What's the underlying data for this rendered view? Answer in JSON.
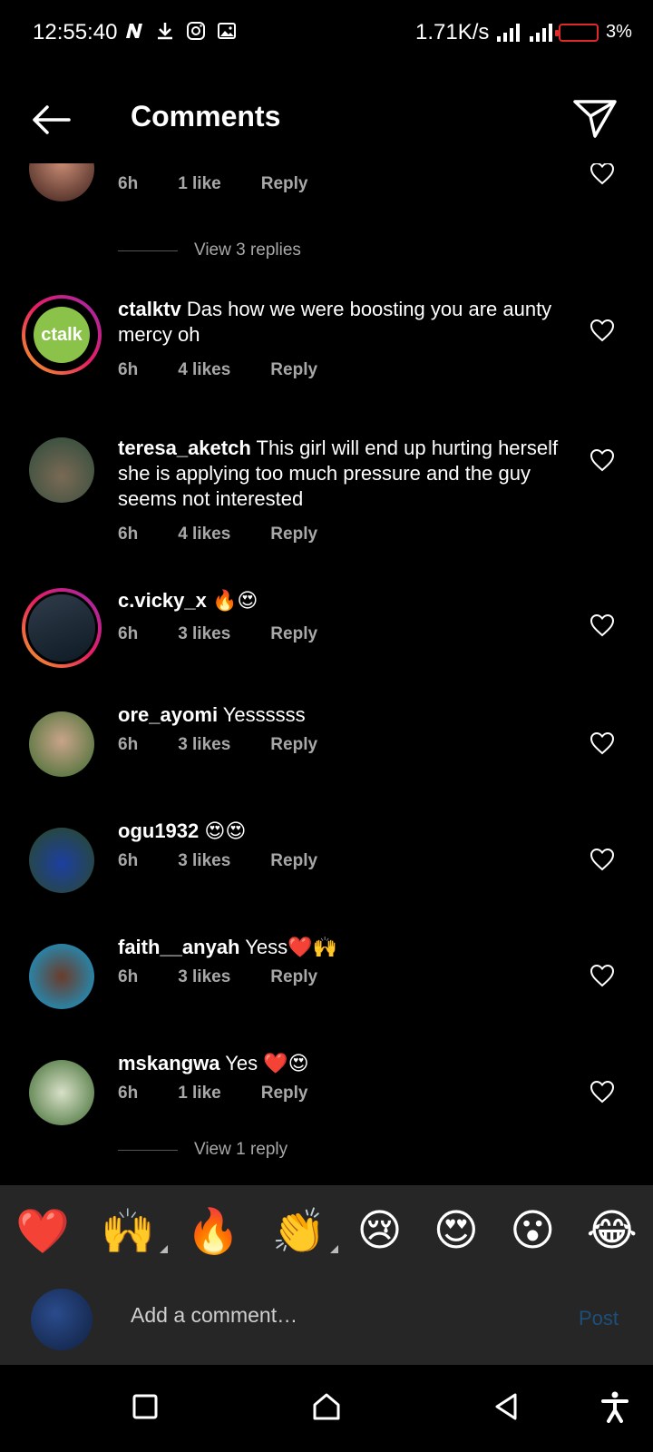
{
  "status_bar": {
    "time": "12:55:40",
    "speed": "1.71K/s",
    "battery_pct": "3%",
    "battery_color": "#e02a2a"
  },
  "header": {
    "title": "Comments"
  },
  "comments_top": {
    "meta": {
      "time": "6h",
      "likes": "1 like",
      "reply": "Reply"
    },
    "view_replies": "View 3 replies"
  },
  "comments": [
    {
      "username": "ctalktv",
      "text": "Das how we were boosting you are aunty mercy oh",
      "time": "6h",
      "likes": "4 likes",
      "reply": "Reply",
      "avatar_label": "ctalk"
    },
    {
      "username": "teresa_aketch",
      "text": "This girl will end up hurting herself she is applying too much pressure and the guy seems not interested",
      "time": "6h",
      "likes": "4 likes",
      "reply": "Reply"
    },
    {
      "username": "c.vicky_x",
      "text": "🔥😍",
      "time": "6h",
      "likes": "3 likes",
      "reply": "Reply"
    },
    {
      "username": "ore_ayomi",
      "text": "Yessssss",
      "time": "6h",
      "likes": "3 likes",
      "reply": "Reply"
    },
    {
      "username": "ogu1932",
      "text": "😍😍",
      "time": "6h",
      "likes": "3 likes",
      "reply": "Reply"
    },
    {
      "username": "faith__anyah",
      "text": "Yess❤️🙌",
      "time": "6h",
      "likes": "3 likes",
      "reply": "Reply"
    },
    {
      "username": "mskangwa",
      "text": "Yes ❤️😍",
      "time": "6h",
      "likes": "1 like",
      "reply": "Reply"
    }
  ],
  "comments_bottom": {
    "view_replies": "View 1 reply"
  },
  "emoji_bar": [
    "❤️",
    "🙌",
    "🔥",
    "👏",
    "😢",
    "😍",
    "😮",
    "😂"
  ],
  "input": {
    "placeholder": "Add a comment…",
    "post": "Post"
  }
}
